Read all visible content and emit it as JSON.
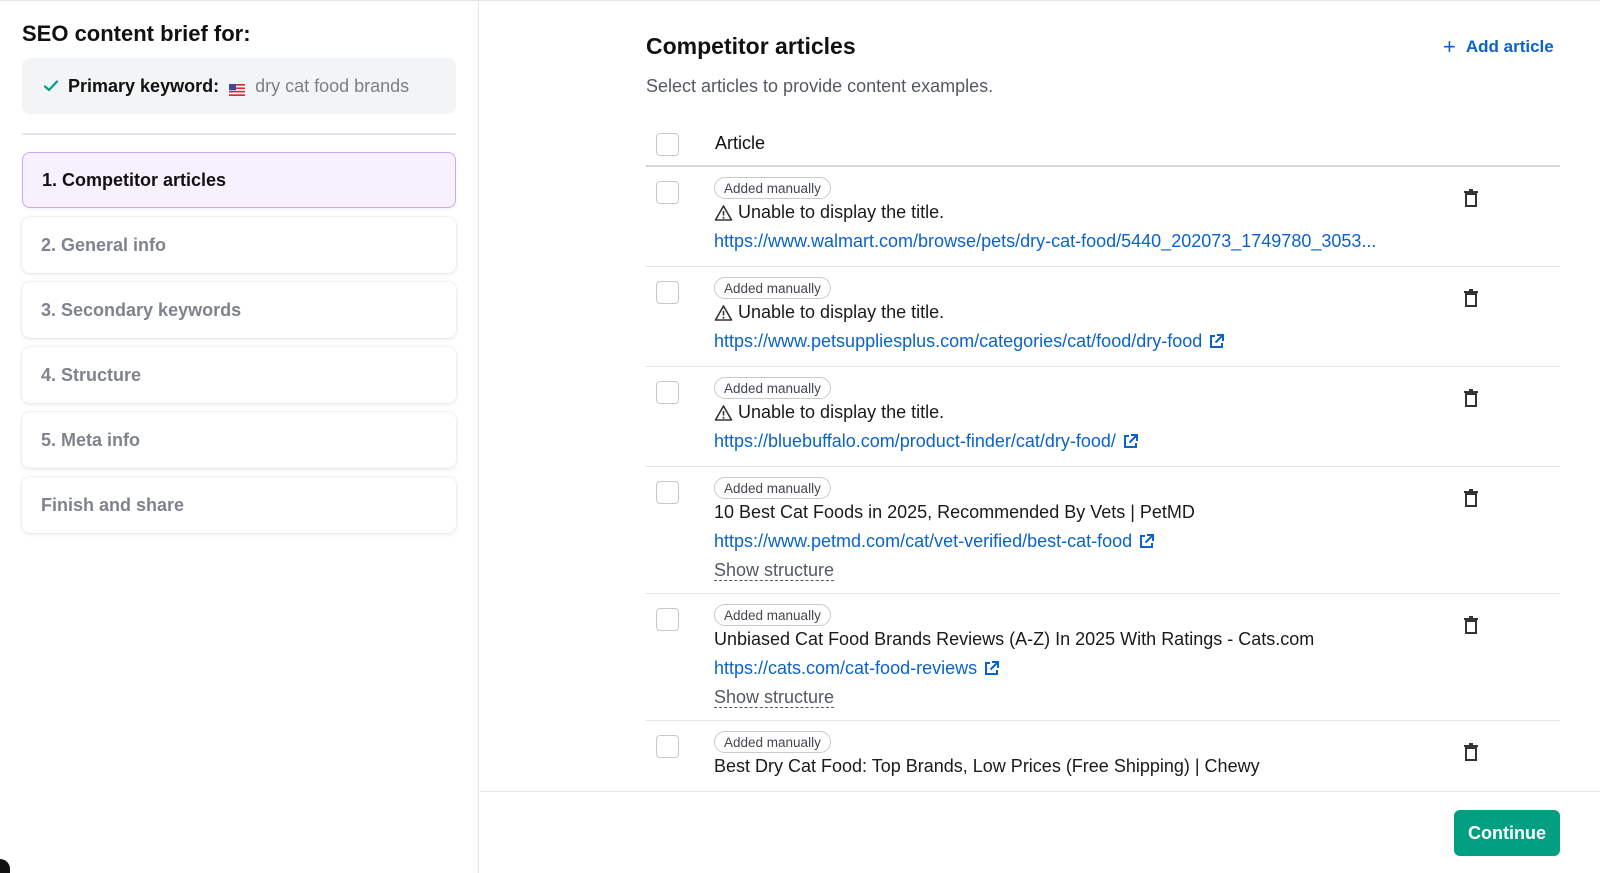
{
  "sidebar": {
    "heading": "SEO content brief for:",
    "keyword_label": "Primary keyword:",
    "keyword_value": "dry cat food brands",
    "steps": [
      {
        "label": "1. Competitor articles",
        "active": true
      },
      {
        "label": "2. General info",
        "active": false
      },
      {
        "label": "3. Secondary keywords",
        "active": false
      },
      {
        "label": "4. Structure",
        "active": false
      },
      {
        "label": "5. Meta info",
        "active": false
      },
      {
        "label": "Finish and share",
        "active": false
      }
    ]
  },
  "main": {
    "title": "Competitor articles",
    "add_article": "Add article",
    "subtitle": "Select articles to provide content examples.",
    "column_header": "Article",
    "articles": [
      {
        "badge": "Added manually",
        "title": "Unable to display the title.",
        "warning": true,
        "url": "https://www.walmart.com/browse/pets/dry-cat-food/5440_202073_1749780_3053...",
        "external_icon": false,
        "show_structure": ""
      },
      {
        "badge": "Added manually",
        "title": "Unable to display the title.",
        "warning": true,
        "url": "https://www.petsuppliesplus.com/categories/cat/food/dry-food",
        "external_icon": true,
        "show_structure": ""
      },
      {
        "badge": "Added manually",
        "title": "Unable to display the title.",
        "warning": true,
        "url": "https://bluebuffalo.com/product-finder/cat/dry-food/",
        "external_icon": true,
        "show_structure": ""
      },
      {
        "badge": "Added manually",
        "title": "10 Best Cat Foods in 2025, Recommended By Vets | PetMD",
        "warning": false,
        "url": "https://www.petmd.com/cat/vet-verified/best-cat-food",
        "external_icon": true,
        "show_structure": "Show structure"
      },
      {
        "badge": "Added manually",
        "title": "Unbiased Cat Food Brands Reviews (A-Z) In 2025 With Ratings - Cats.com",
        "warning": false,
        "url": "https://cats.com/cat-food-reviews",
        "external_icon": true,
        "show_structure": "Show structure"
      },
      {
        "badge": "Added manually",
        "title": "Best Dry Cat Food: Top Brands, Low Prices (Free Shipping) | Chewy",
        "warning": false,
        "url": "",
        "external_icon": false,
        "show_structure": ""
      }
    ]
  },
  "footer": {
    "continue_label": "Continue"
  },
  "colors": {
    "accent_link": "#0a63cc",
    "active_step_bg": "#f6f0ff",
    "active_step_border": "#c9a8f5",
    "continue_bg": "#009f81",
    "check_green": "#009f81"
  },
  "icons": [
    "check-icon",
    "us-flag-icon",
    "plus-icon",
    "warning-icon",
    "external-link-icon",
    "trash-icon"
  ]
}
